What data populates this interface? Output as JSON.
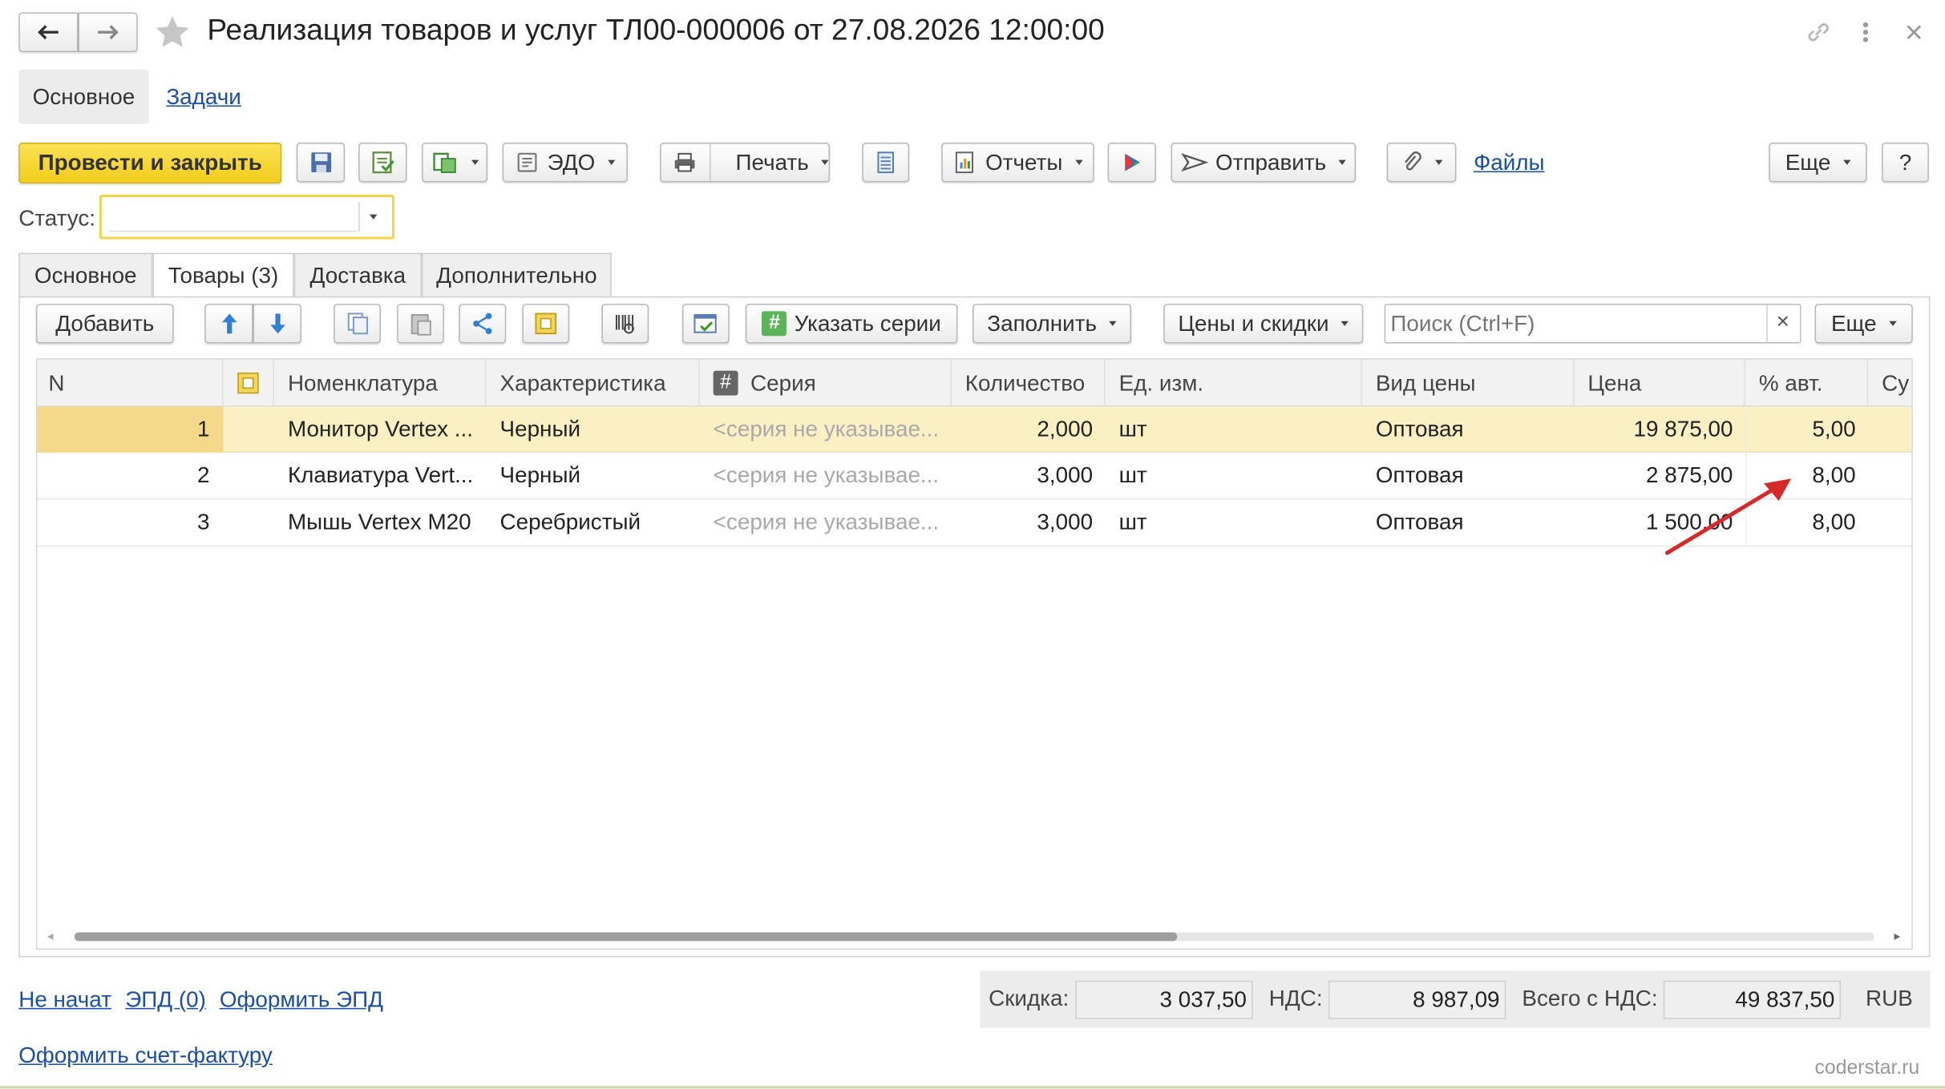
{
  "window": {
    "title": "Реализация товаров и услуг ТЛ00-000006 от 27.08.2026 12:00:00",
    "nav_main": "Основное",
    "nav_tasks": "Задачи"
  },
  "toolbar": {
    "post_close": "Провести и закрыть",
    "edo": "ЭДО",
    "print": "Печать",
    "reports": "Отчеты",
    "send": "Отправить",
    "files": "Файлы",
    "more": "Еще",
    "help": "?"
  },
  "status": {
    "label": "Статус:",
    "value": ""
  },
  "tabs": [
    "Основное",
    "Товары (3)",
    "Доставка",
    "Дополнительно"
  ],
  "goods_toolbar": {
    "add": "Добавить",
    "series": "Указать серии",
    "fill": "Заполнить",
    "prices": "Цены и скидки",
    "search_placeholder": "Поиск (Ctrl+F)",
    "clear": "×",
    "more": "Еще"
  },
  "table": {
    "columns": [
      "N",
      "",
      "Номенклатура",
      "Характеристика",
      "Серия",
      "Количество",
      "Ед. изм.",
      "Вид цены",
      "Цена",
      "% авт.",
      "Су"
    ],
    "rows": [
      {
        "n": "1",
        "nomenclature": "Монитор Vertex ...",
        "characteristic": "Черный",
        "series": "<серия не указывае...",
        "qty": "2,000",
        "unit": "шт",
        "price_type": "Оптовая",
        "price": "19 875,00",
        "auto_pct": "5,00"
      },
      {
        "n": "2",
        "nomenclature": "Клавиатура Vert...",
        "characteristic": "Черный",
        "series": "<серия не указывае...",
        "qty": "3,000",
        "unit": "шт",
        "price_type": "Оптовая",
        "price": "2 875,00",
        "auto_pct": "8,00"
      },
      {
        "n": "3",
        "nomenclature": "Мышь Vertex M20",
        "characteristic": "Серебристый",
        "series": "<серия не указывае...",
        "qty": "3,000",
        "unit": "шт",
        "price_type": "Оптовая",
        "price": "1 500,00",
        "auto_pct": "8,00"
      }
    ]
  },
  "footer": {
    "not_started": "Не начат",
    "epd": "ЭПД (0)",
    "make_epd": "Оформить ЭПД",
    "make_invoice": "Оформить счет-фактуру",
    "discount_label": "Скидка:",
    "discount": "3 037,50",
    "vat_label": "НДС:",
    "vat": "8 987,09",
    "total_label": "Всего с НДС:",
    "total": "49 837,50",
    "currency": "RUB",
    "watermark": "coderstar.ru"
  },
  "colors": {
    "accent_yellow": "#f5d833",
    "selected_row": "#fbf0c4",
    "link": "#1b4fa3",
    "arrow": "#d42a2a"
  }
}
